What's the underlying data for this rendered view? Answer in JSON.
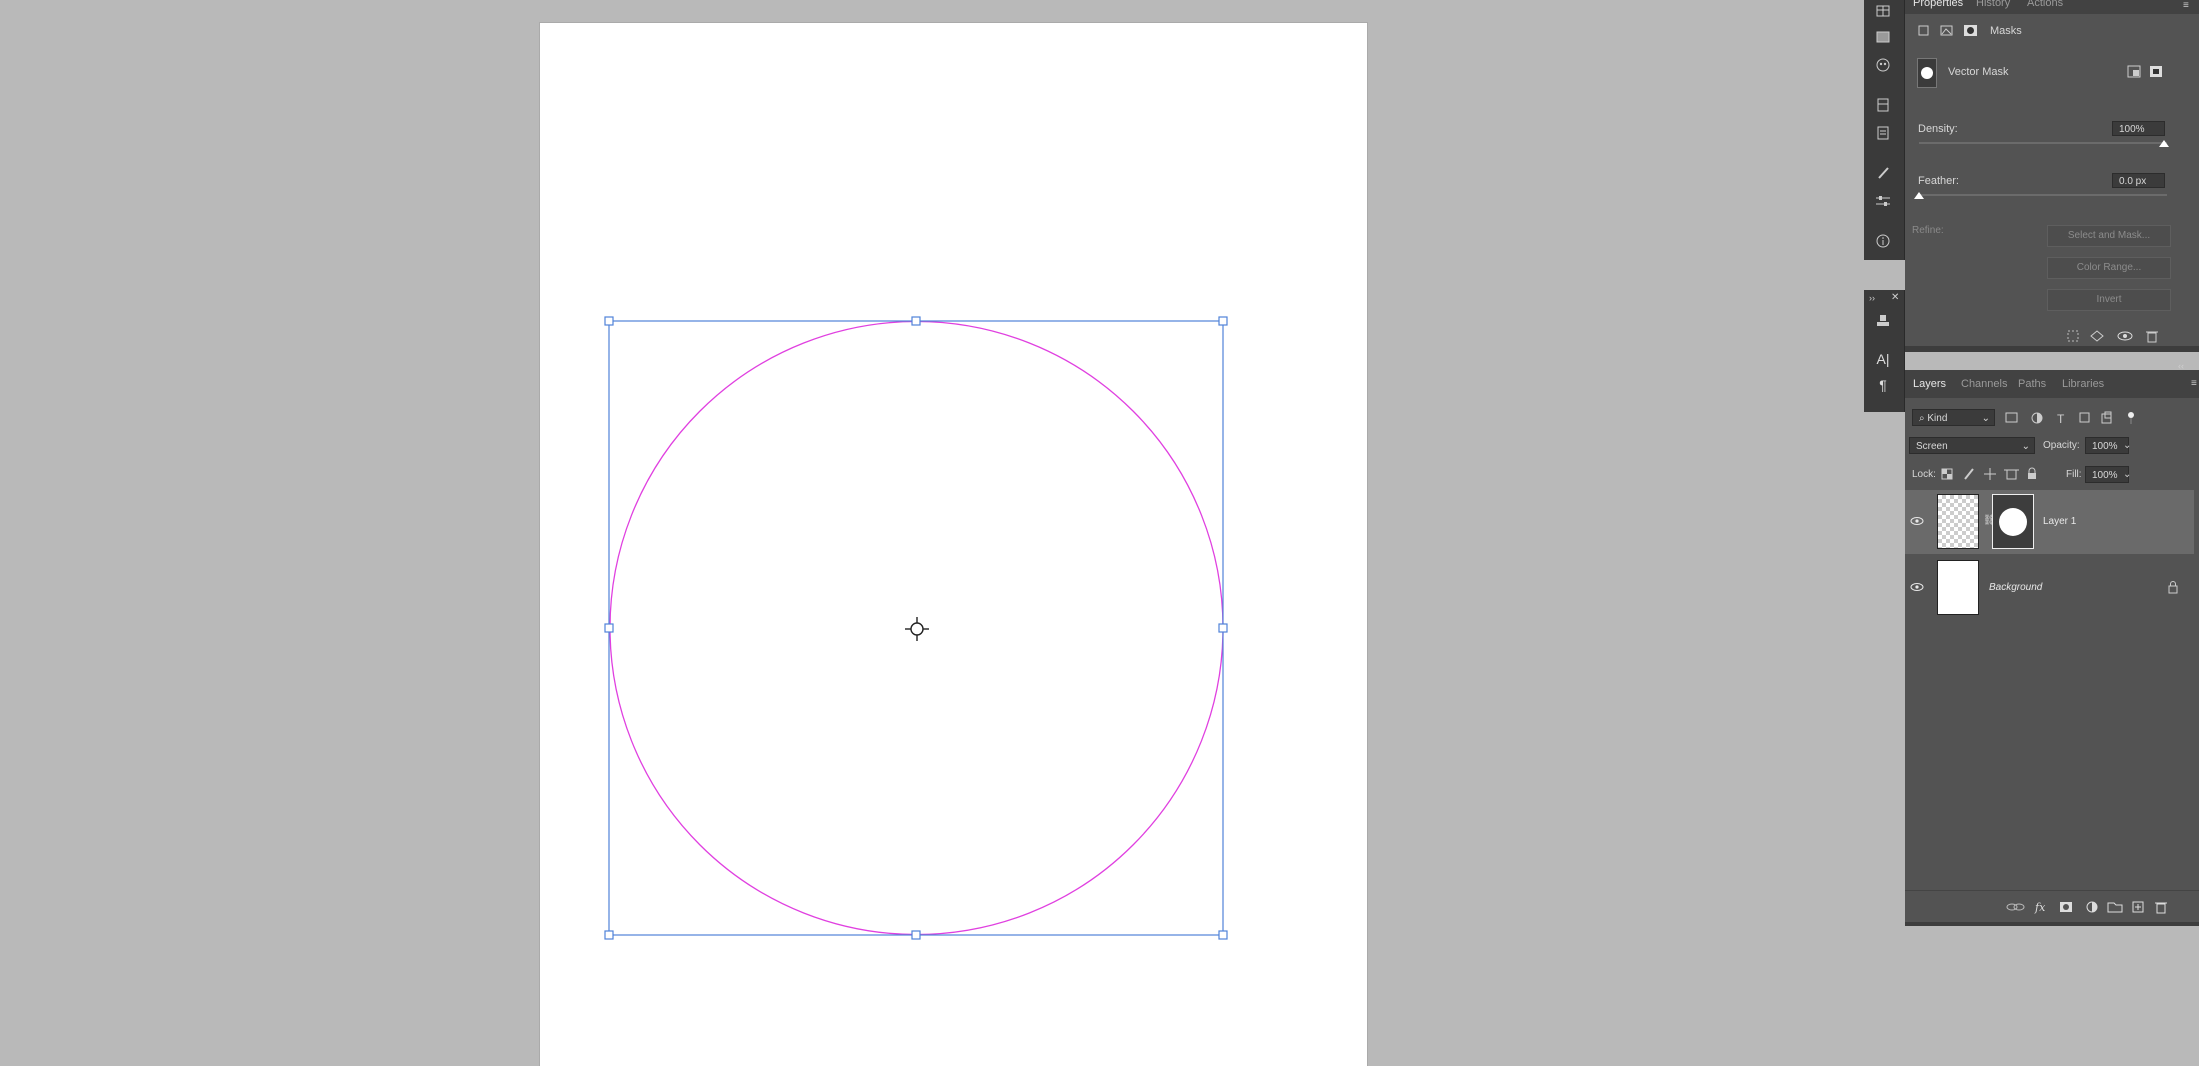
{
  "properties_panel": {
    "tabs": [
      "Properties",
      "History",
      "Actions"
    ],
    "section_label": "Masks",
    "mask_type": "Vector Mask",
    "density_label": "Density:",
    "density_value": "100%",
    "density_fraction": 1.0,
    "feather_label": "Feather:",
    "feather_value": "0.0 px",
    "feather_fraction": 0.0,
    "refine_label": "Refine:",
    "buttons": [
      "Select and Mask...",
      "Color Range...",
      "Invert"
    ]
  },
  "layers_panel": {
    "tabs": [
      "Layers",
      "Channels",
      "Paths",
      "Libraries"
    ],
    "filter_kind": "Kind",
    "blend_mode": "Screen",
    "opacity_label": "Opacity:",
    "opacity_value": "100%",
    "lock_label": "Lock:",
    "fill_label": "Fill:",
    "fill_value": "100%",
    "layers": [
      {
        "name": "Layer 1",
        "selected": true,
        "visible": true
      },
      {
        "name": "Background",
        "selected": false,
        "visible": true,
        "locked": true
      }
    ]
  },
  "colors": {
    "workspace": "#b9b9b9",
    "panel": "#535353",
    "selection_box": "#4f83d9",
    "path": "#e040e0"
  }
}
